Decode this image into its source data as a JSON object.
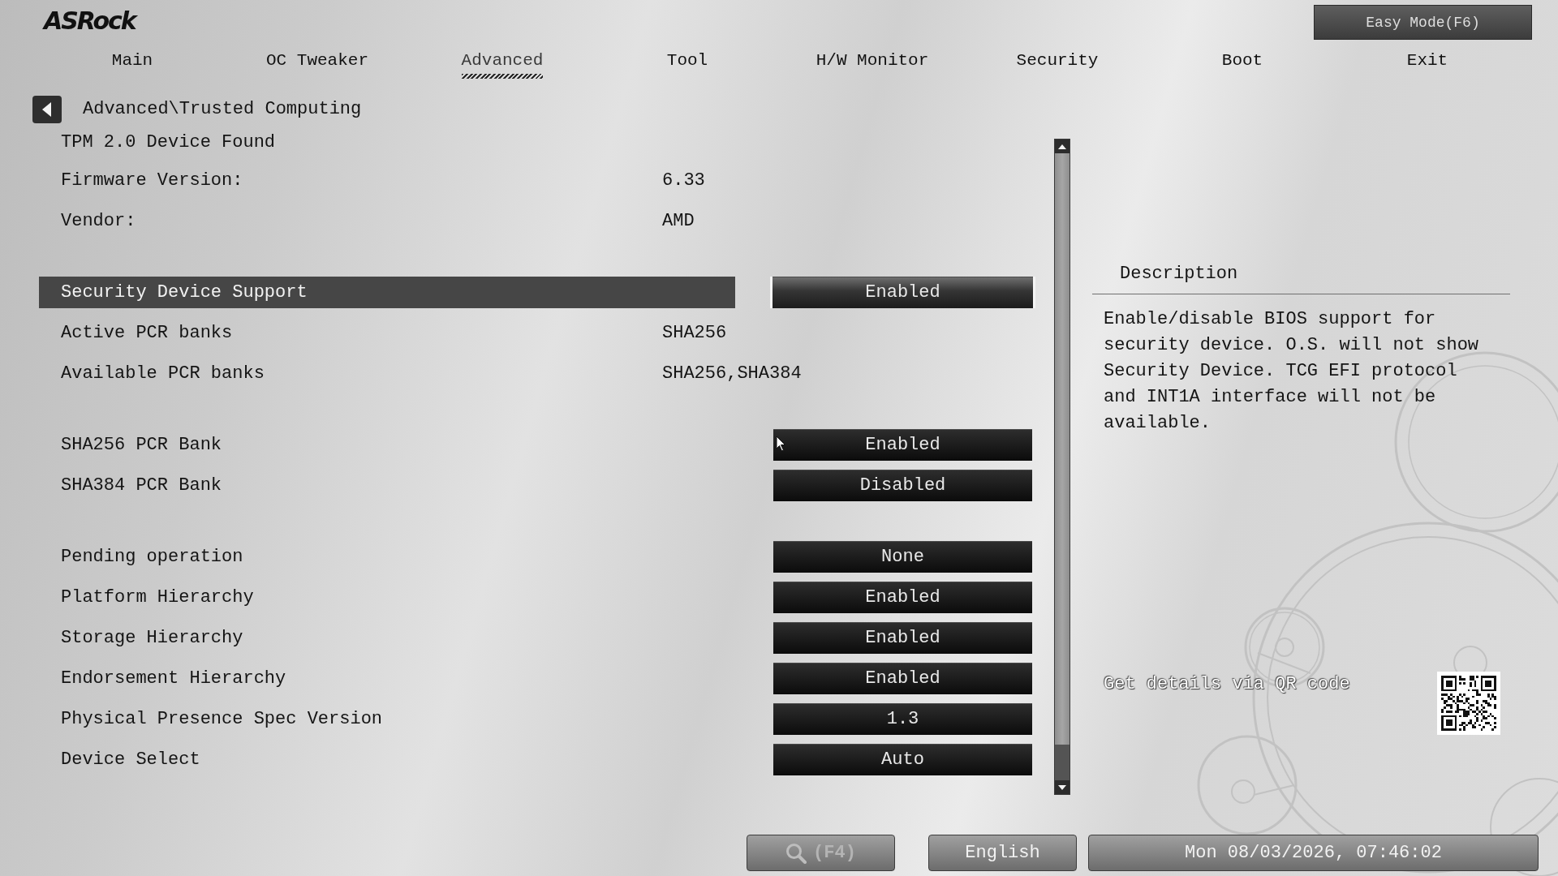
{
  "logo": "ASRock",
  "easy_mode_button": {
    "label": "Easy Mode(F6)"
  },
  "tabs": [
    {
      "label": "Main",
      "selected": false
    },
    {
      "label": "OC Tweaker",
      "selected": false
    },
    {
      "label": "Advanced",
      "selected": true
    },
    {
      "label": "Tool",
      "selected": false
    },
    {
      "label": "H/W Monitor",
      "selected": false
    },
    {
      "label": "Security",
      "selected": false
    },
    {
      "label": "Boot",
      "selected": false
    },
    {
      "label": "Exit",
      "selected": false
    }
  ],
  "breadcrumb": "Advanced\\Trusted Computing",
  "settings": [
    [
      {
        "kind": "info",
        "label": "TPM 2.0 Device Found",
        "selected": false
      },
      {
        "kind": "info",
        "label": "Firmware Version:",
        "value": "6.33",
        "selected": false
      },
      {
        "kind": "info",
        "label": "Vendor:",
        "value": "AMD",
        "selected": false
      }
    ],
    [
      {
        "kind": "option",
        "label": "Security Device Support",
        "value": "Enabled",
        "selected": true
      },
      {
        "kind": "info",
        "label": "Active PCR banks",
        "value": "SHA256",
        "selected": false
      },
      {
        "kind": "info",
        "label": "Available PCR banks",
        "value": "SHA256,SHA384",
        "selected": false
      }
    ],
    [
      {
        "kind": "option",
        "label": "SHA256 PCR Bank",
        "value": "Enabled",
        "selected": false
      },
      {
        "kind": "option",
        "label": "SHA384 PCR Bank",
        "value": "Disabled",
        "selected": false
      }
    ],
    [
      {
        "kind": "option",
        "label": "Pending operation",
        "value": "None",
        "selected": false
      },
      {
        "kind": "option",
        "label": "Platform Hierarchy",
        "value": "Enabled",
        "selected": false
      },
      {
        "kind": "option",
        "label": "Storage Hierarchy",
        "value": "Enabled",
        "selected": false
      },
      {
        "kind": "option",
        "label": "Endorsement Hierarchy",
        "value": "Enabled",
        "selected": false
      },
      {
        "kind": "option",
        "label": "Physical Presence Spec Version",
        "value": "1.3",
        "selected": false
      },
      {
        "kind": "option",
        "label": "Device Select",
        "value": "Auto",
        "selected": false
      }
    ]
  ],
  "description": {
    "title": "Description",
    "text": "Enable/disable BIOS support for security device. O.S. will not show Security Device. TCG EFI protocol and INT1A interface will not be available."
  },
  "qr": {
    "caption": "Get details via QR code"
  },
  "bottom_bar": {
    "buttons": [
      {
        "kind": "search",
        "label": "(F4)",
        "disabled": true
      },
      {
        "kind": "language",
        "label": "English",
        "disabled": false
      }
    ],
    "datetime": "Mon 08/03/2026, 07:46:02"
  }
}
